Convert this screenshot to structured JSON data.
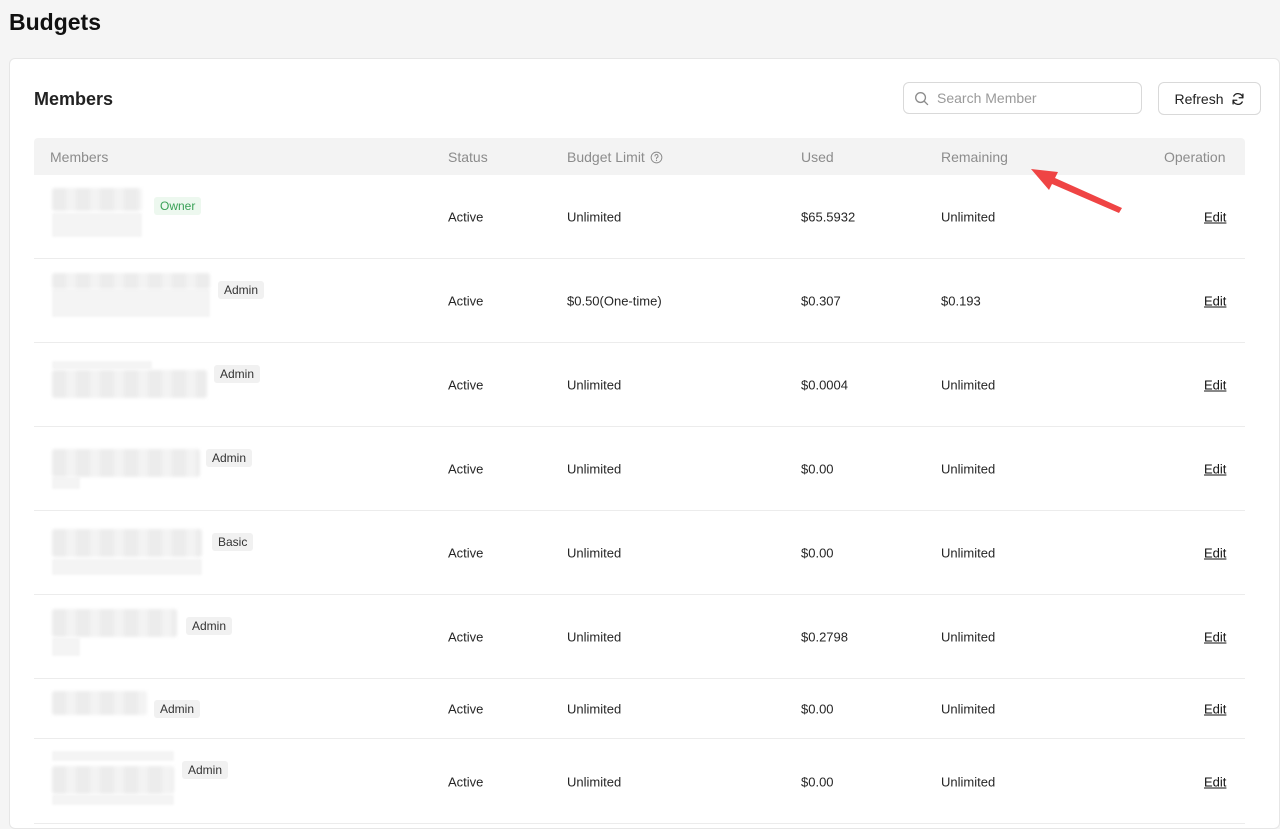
{
  "page": {
    "title": "Budgets"
  },
  "card": {
    "title": "Members",
    "search": {
      "placeholder": "Search Member",
      "value": ""
    },
    "refresh_label": "Refresh"
  },
  "table": {
    "columns": {
      "members": "Members",
      "status": "Status",
      "budget_limit": "Budget Limit",
      "used": "Used",
      "remaining": "Remaining",
      "operation": "Operation"
    },
    "rows": [
      {
        "role": "Owner",
        "status": "Active",
        "budget_limit": "Unlimited",
        "used": "$65.5932",
        "remaining": "Unlimited",
        "operation": "Edit"
      },
      {
        "role": "Admin",
        "status": "Active",
        "budget_limit": "$0.50(One-time)",
        "used": "$0.307",
        "remaining": "$0.193",
        "operation": "Edit"
      },
      {
        "role": "Admin",
        "status": "Active",
        "budget_limit": "Unlimited",
        "used": "$0.0004",
        "remaining": "Unlimited",
        "operation": "Edit"
      },
      {
        "role": "Admin",
        "status": "Active",
        "budget_limit": "Unlimited",
        "used": "$0.00",
        "remaining": "Unlimited",
        "operation": "Edit"
      },
      {
        "role": "Basic",
        "status": "Active",
        "budget_limit": "Unlimited",
        "used": "$0.00",
        "remaining": "Unlimited",
        "operation": "Edit"
      },
      {
        "role": "Admin",
        "status": "Active",
        "budget_limit": "Unlimited",
        "used": "$0.2798",
        "remaining": "Unlimited",
        "operation": "Edit"
      },
      {
        "role": "Admin",
        "status": "Active",
        "budget_limit": "Unlimited",
        "used": "$0.00",
        "remaining": "Unlimited",
        "operation": "Edit"
      },
      {
        "role": "Admin",
        "status": "Active",
        "budget_limit": "Unlimited",
        "used": "$0.00",
        "remaining": "Unlimited",
        "operation": "Edit"
      }
    ]
  },
  "colors": {
    "owner_tag": "#3aa157",
    "annotation_arrow": "#ef4444"
  }
}
